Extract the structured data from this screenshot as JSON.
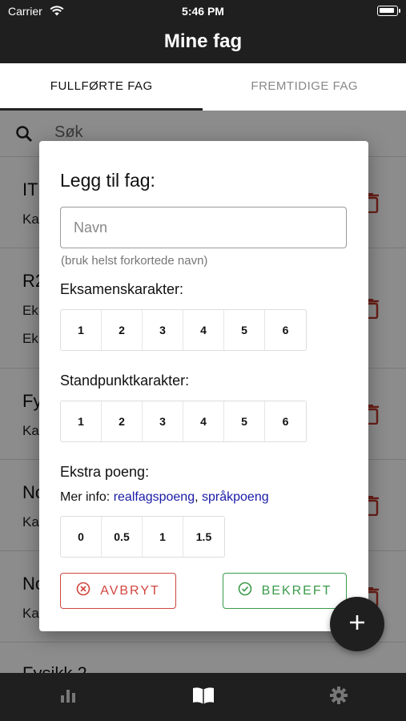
{
  "status": {
    "carrier": "Carrier",
    "time": "5:46 PM"
  },
  "header": {
    "title": "Mine fag"
  },
  "tabs": [
    {
      "label": "FULLFØRTE FAG",
      "active": true
    },
    {
      "label": "FREMTIDIGE FAG",
      "active": false
    }
  ],
  "search": {
    "placeholder": "Søk"
  },
  "list": [
    {
      "title": "IT",
      "lines": [
        "Ka"
      ]
    },
    {
      "title": "R2",
      "lines": [
        "Ek",
        "Ek"
      ]
    },
    {
      "title": "Fy",
      "lines": [
        "Ka"
      ]
    },
    {
      "title": "No",
      "lines": [
        "Ka"
      ]
    },
    {
      "title": "No",
      "lines": [
        "Ka"
      ]
    },
    {
      "title": "Fysikk 2",
      "lines": []
    }
  ],
  "dialog": {
    "title": "Legg til fag:",
    "name_placeholder": "Navn",
    "name_hint": "(bruk helst forkortede navn)",
    "exam_label": "Eksamenskarakter:",
    "exam_grades": [
      "1",
      "2",
      "3",
      "4",
      "5",
      "6"
    ],
    "standpoint_label": "Standpunktkarakter:",
    "standpoint_grades": [
      "1",
      "2",
      "3",
      "4",
      "5",
      "6"
    ],
    "extra_label": "Ekstra poeng:",
    "info_prefix": "Mer info: ",
    "info_link1": "realfagspoeng",
    "info_sep": ", ",
    "info_link2": "språkpoeng",
    "extra_points": [
      "0",
      "0.5",
      "1",
      "1.5"
    ],
    "cancel_label": "AVBRYT",
    "confirm_label": "BEKREFT"
  },
  "colors": {
    "accent_dark": "#1f1f1f",
    "cancel": "#d0453f",
    "confirm": "#3a9a4a",
    "link": "#1a1aa6"
  },
  "icons": {
    "fab": "plus-icon",
    "nav": [
      "bar-chart-icon",
      "open-book-icon",
      "gear-icon"
    ]
  }
}
